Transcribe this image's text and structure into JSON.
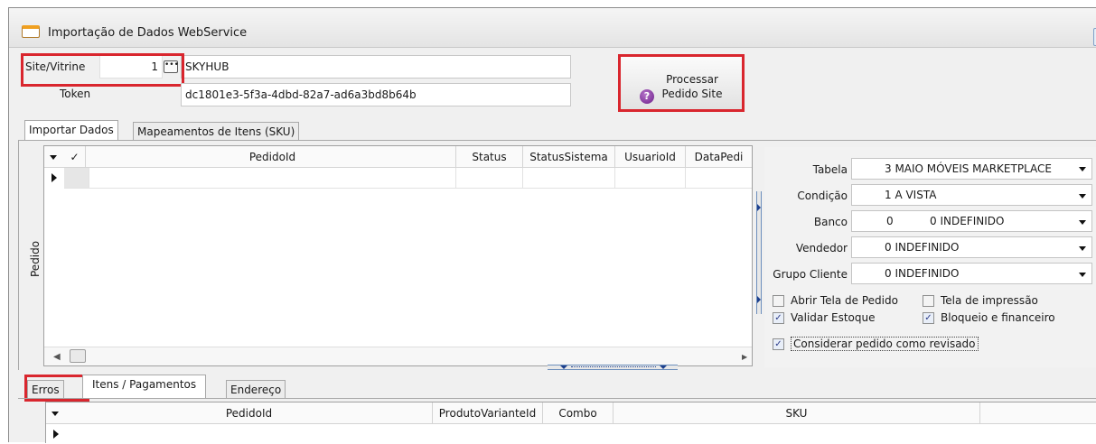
{
  "window": {
    "title": "Importação de Dados WebService"
  },
  "header": {
    "site_label": "Site/Vitrine",
    "site_value": "1",
    "site_name": "SKYHUB",
    "token_label": "Token",
    "token_value": "dc1801e3-5f3a-4dbd-82a7-ad6a3bd8b64b",
    "process_button_line1": "Processar",
    "process_button_line2": "Pedido Site"
  },
  "tabs": [
    {
      "label": "Importar Dados",
      "active": true
    },
    {
      "label": "Mapeamentos de Itens (SKU)",
      "active": false
    }
  ],
  "pedido_grid": {
    "side_label": "Pedido",
    "check_header": "✓",
    "columns": [
      "PedidoId",
      "Status",
      "StatusSistema",
      "UsuarioId",
      "DataPedi"
    ]
  },
  "options": {
    "tabela_label": "Tabela",
    "tabela_value": "3 MAIO MÓVEIS MARKETPLACE",
    "condicao_label": "Condição",
    "condicao_value": "1 A VISTA",
    "banco_label": "Banco",
    "banco_value1": "0",
    "banco_value2": "0 INDEFINIDO",
    "vendedor_label": "Vendedor",
    "vendedor_value": "0 INDEFINIDO",
    "grupo_label": "Grupo Cliente",
    "grupo_value": "0 INDEFINIDO",
    "checkboxes": [
      {
        "label": "Abrir Tela de Pedido",
        "checked": false
      },
      {
        "label": "Tela de impressão",
        "checked": false
      },
      {
        "label": "Validar Estoque",
        "checked": true
      },
      {
        "label": "Bloqueio e financeiro",
        "checked": true
      },
      {
        "label": "Considerar pedido como revisado",
        "checked": true
      }
    ]
  },
  "bottom_tabs": [
    {
      "label": "Erros",
      "active": false
    },
    {
      "label": "Itens / Pagamentos",
      "active": true
    },
    {
      "label": "Endereço",
      "active": false
    }
  ],
  "items_grid": {
    "columns": [
      "PedidoId",
      "ProdutoVarianteId",
      "Combo",
      "SKU"
    ]
  },
  "colors": {
    "highlight": "#d9262e",
    "window_bg": "#f0f0f0"
  }
}
